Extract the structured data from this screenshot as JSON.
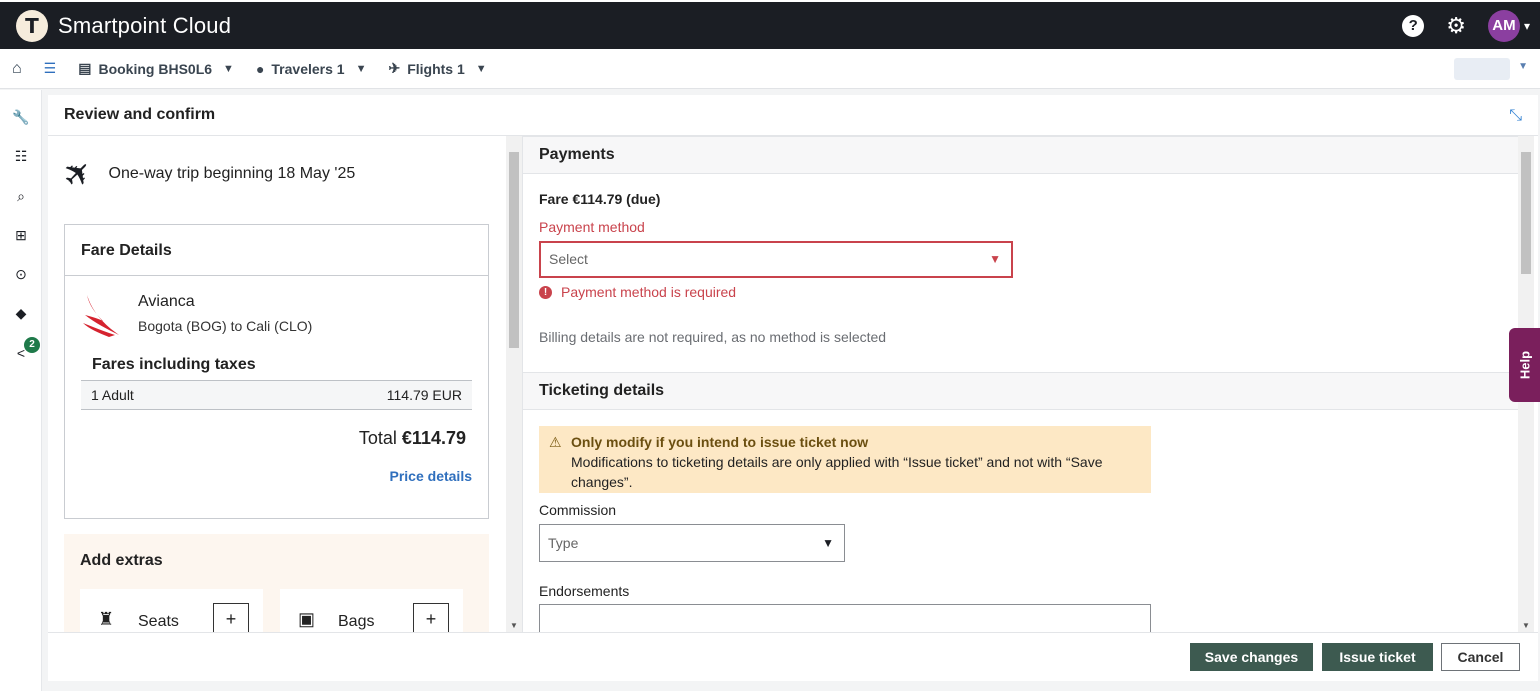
{
  "app": {
    "title": "Smartpoint Cloud",
    "logo_letter": "T",
    "avatar_initials": "AM"
  },
  "subnav": {
    "booking": "Booking BHS0L6",
    "travelers": "Travelers 1",
    "flights": "Flights 1"
  },
  "rail": {
    "share_badge": "2"
  },
  "panel": {
    "title": "Review and confirm"
  },
  "trip": {
    "summary": "One-way trip beginning 18 May '25"
  },
  "fare_details": {
    "title": "Fare Details",
    "airline": "Avianca",
    "route": "Bogota (BOG) to Cali (CLO)",
    "fares_heading": "Fares including taxes",
    "rows": [
      {
        "passenger": "1 Adult",
        "amount": "114.79 EUR"
      }
    ],
    "total_label": "Total",
    "total_value": "€114.79",
    "price_details_link": "Price details"
  },
  "extras": {
    "title": "Add extras",
    "items": [
      {
        "label": "Seats",
        "plus": "+"
      },
      {
        "label": "Bags",
        "plus": "+"
      }
    ]
  },
  "payments": {
    "title": "Payments",
    "fare_due": "Fare €114.79 (due)",
    "method_label": "Payment method",
    "method_placeholder": "Select",
    "error": "Payment method is required",
    "billing_note": "Billing details are not required, as no method is selected"
  },
  "ticketing": {
    "title": "Ticketing details",
    "warning_title": "Only modify if you intend to issue ticket now",
    "warning_text": "Modifications to ticketing details are only applied with “Issue ticket” and not with “Save changes”.",
    "commission_label": "Commission",
    "commission_placeholder": "Type",
    "endorsements_label": "Endorsements",
    "endorsements_value": ""
  },
  "footer": {
    "save": "Save changes",
    "issue": "Issue ticket",
    "cancel": "Cancel"
  },
  "help_tab": "Help",
  "colors": {
    "topbar": "#1b1e24",
    "error": "#c9434c",
    "primary_button": "#3d5a50",
    "avatar": "#8b3fa0",
    "help_tab": "#7a1f5c",
    "link": "#2f6fbd"
  }
}
